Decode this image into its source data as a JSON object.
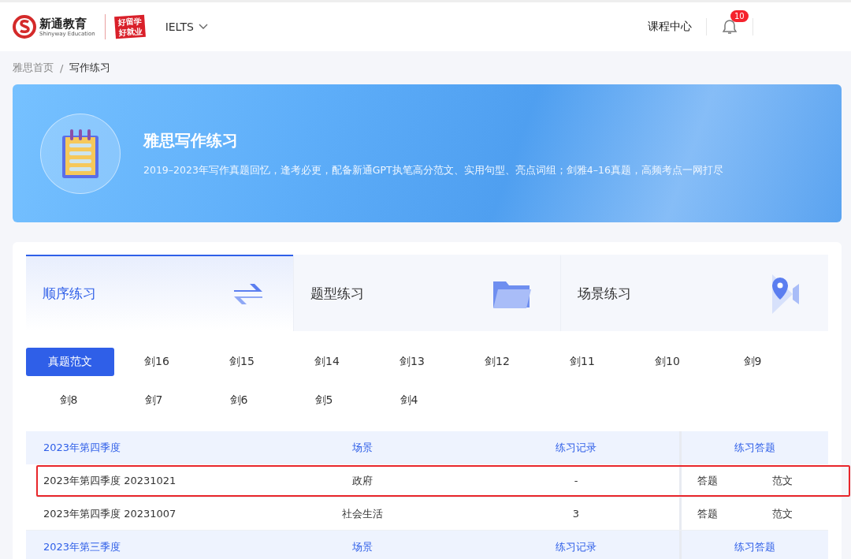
{
  "header": {
    "brand_name": "新通教育",
    "brand_sub": "Shinyway Education",
    "slogan": [
      "好留学",
      "好就业"
    ],
    "exam_selector": "IELTS",
    "nav_link": "课程中心",
    "notification_count": "10"
  },
  "breadcrumb_separator": "/",
  "breadcrumb": [
    {
      "label": "雅思首页",
      "current": false
    },
    {
      "label": "写作练习",
      "current": true
    }
  ],
  "banner": {
    "title": "雅思写作练习",
    "description": "2019–2023年写作真题回忆，逢考必更，配备新通GPT执笔高分范文、实用句型、亮点词组；剑雅4–16真题，高频考点一网打尽"
  },
  "practice_tabs": [
    {
      "label": "顺序练习",
      "kind": "swap",
      "selected": true
    },
    {
      "label": "题型练习",
      "kind": "folder",
      "selected": false
    },
    {
      "label": "场景练习",
      "kind": "pin",
      "selected": false
    }
  ],
  "filters": [
    {
      "label": "真题范文",
      "selected": true
    },
    {
      "label": "剑16",
      "selected": false
    },
    {
      "label": "剑15",
      "selected": false
    },
    {
      "label": "剑14",
      "selected": false
    },
    {
      "label": "剑13",
      "selected": false
    },
    {
      "label": "剑12",
      "selected": false
    },
    {
      "label": "剑11",
      "selected": false
    },
    {
      "label": "剑10",
      "selected": false
    },
    {
      "label": "剑9",
      "selected": false
    },
    {
      "label": "剑8",
      "selected": false
    },
    {
      "label": "剑7",
      "selected": false
    },
    {
      "label": "剑6",
      "selected": false
    },
    {
      "label": "剑5",
      "selected": false
    },
    {
      "label": "剑4",
      "selected": false
    }
  ],
  "table": {
    "rows": [
      {
        "kind": "group",
        "cells": [
          "2023年第四季度",
          "场景",
          "练习记录",
          "练习答题"
        ]
      },
      {
        "kind": "item",
        "highlighted": true,
        "cells": [
          "2023年第四季度 20231021",
          "政府",
          "-"
        ],
        "actions": [
          "答题",
          "范文"
        ]
      },
      {
        "kind": "item",
        "highlighted": false,
        "cells": [
          "2023年第四季度 20231007",
          "社会生活",
          "3"
        ],
        "actions": [
          "答题",
          "范文"
        ]
      },
      {
        "kind": "group",
        "cells": [
          "2023年第三季度",
          "场景",
          "练习记录",
          "练习答题"
        ]
      }
    ]
  }
}
